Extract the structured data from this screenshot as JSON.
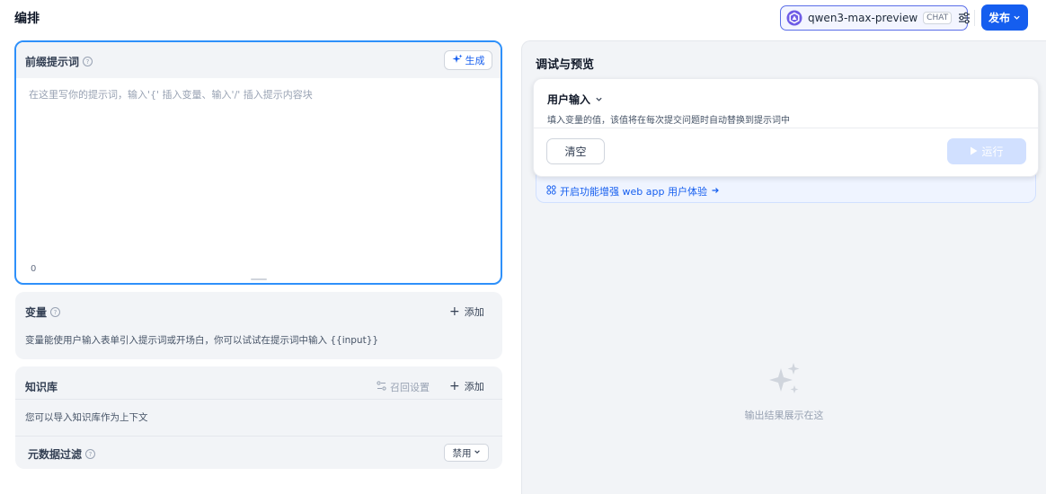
{
  "header": {
    "title": "编排",
    "model": {
      "name": "qwen3-max-preview",
      "badge": "CHAT"
    },
    "publish_label": "发布"
  },
  "prompt": {
    "title": "前缀提示词",
    "generate_label": "生成",
    "placeholder": "在这里写你的提示词，输入'{' 插入变量、输入'/' 插入提示内容块",
    "char_count": "0"
  },
  "variables": {
    "title": "变量",
    "add_label": "添加",
    "description": "变量能使用户输入表单引入提示词或开场白，你可以试试在提示词中输入 {{input}}"
  },
  "knowledge": {
    "title": "知识库",
    "recall_label": "召回设置",
    "add_label": "添加",
    "description": "您可以导入知识库作为上下文",
    "metadata_filter": {
      "title": "元数据过滤",
      "value": "禁用"
    }
  },
  "debug": {
    "title": "调试与预览",
    "user_input": {
      "title": "用户输入",
      "description": "填入变量的值，该值将在每次提交问题时自动替换到提示词中",
      "clear_label": "清空",
      "run_label": "运行"
    },
    "enhance_link": "开启功能增强 web app 用户体验",
    "empty_text": "输出结果展示在这"
  },
  "colors": {
    "accent": "#155eef",
    "focus_border": "#2e90fa",
    "panel_bg": "#f2f4f7"
  }
}
